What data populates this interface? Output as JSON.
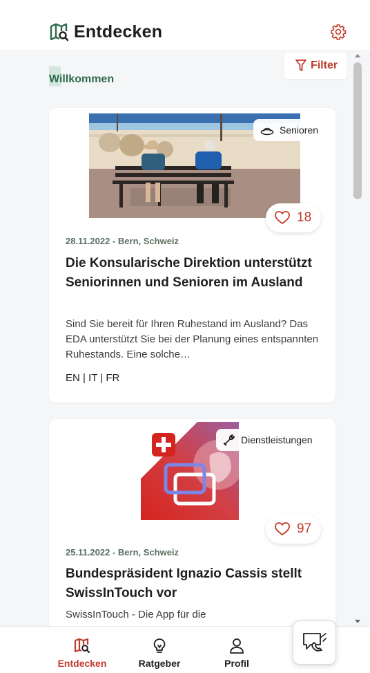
{
  "header": {
    "title": "Entdecken",
    "logo_icon": "map-search-icon",
    "settings_icon": "gear-icon"
  },
  "filter": {
    "label": "Filter",
    "icon": "funnel-icon"
  },
  "welcome": "Willkommen",
  "colors": {
    "accent": "#c0392b",
    "brand_green": "#2c6a4c",
    "background": "#f5f6f8"
  },
  "articles": [
    {
      "tag": "Senioren",
      "tag_icon": "hat-icon",
      "likes": "18",
      "meta": "28.11.2022 - Bern, Schweiz",
      "title": "Die Konsularische Direktion unterstützt Seniorinnen und Senioren im Ausland",
      "excerpt": "Sind Sie bereit für Ihren Ruhestand im Ausland? Das EDA unterstützt Sie bei der Planung eines entspannten Ruhestands. Eine solche…",
      "languages": "EN | IT | FR"
    },
    {
      "tag": "Dienstleistungen",
      "tag_icon": "wrench-icon",
      "likes": "97",
      "meta": "25.11.2022 - Bern, Schweiz",
      "title": "Bundespräsident Ignazio Cassis stellt SwissInTouch vor",
      "excerpt": "SwissInTouch - Die App für die"
    }
  ],
  "nav": [
    {
      "label": "Entdecken",
      "icon": "map-search-icon",
      "active": true
    },
    {
      "label": "Ratgeber",
      "icon": "lightbulb-icon"
    },
    {
      "label": "Profil",
      "icon": "person-icon"
    }
  ],
  "contact_icon": "chat-phone-icon"
}
